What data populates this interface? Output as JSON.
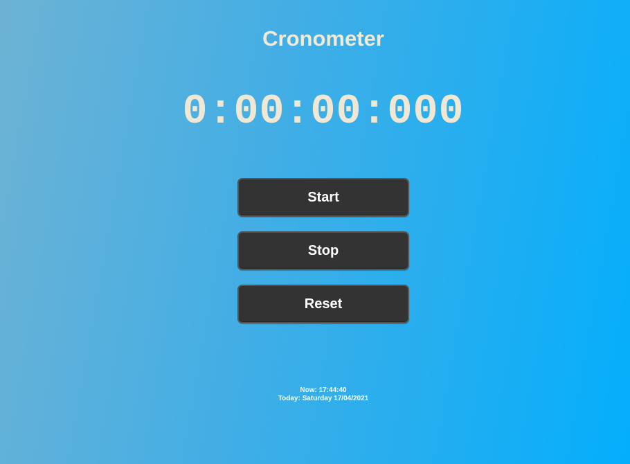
{
  "header": {
    "title": "Cronometer"
  },
  "timer": {
    "display": "0:00:00:000"
  },
  "controls": {
    "start_label": "Start",
    "stop_label": "Stop",
    "reset_label": "Reset"
  },
  "footer": {
    "now": "Now: 17:44:40",
    "today": "Today: Saturday 17/04/2021"
  },
  "colors": {
    "background_start": "#6db2d4",
    "background_end": "#04aefc",
    "button_bg": "#333333",
    "title_text": "#f2ead8",
    "button_text": "#ffffff"
  }
}
